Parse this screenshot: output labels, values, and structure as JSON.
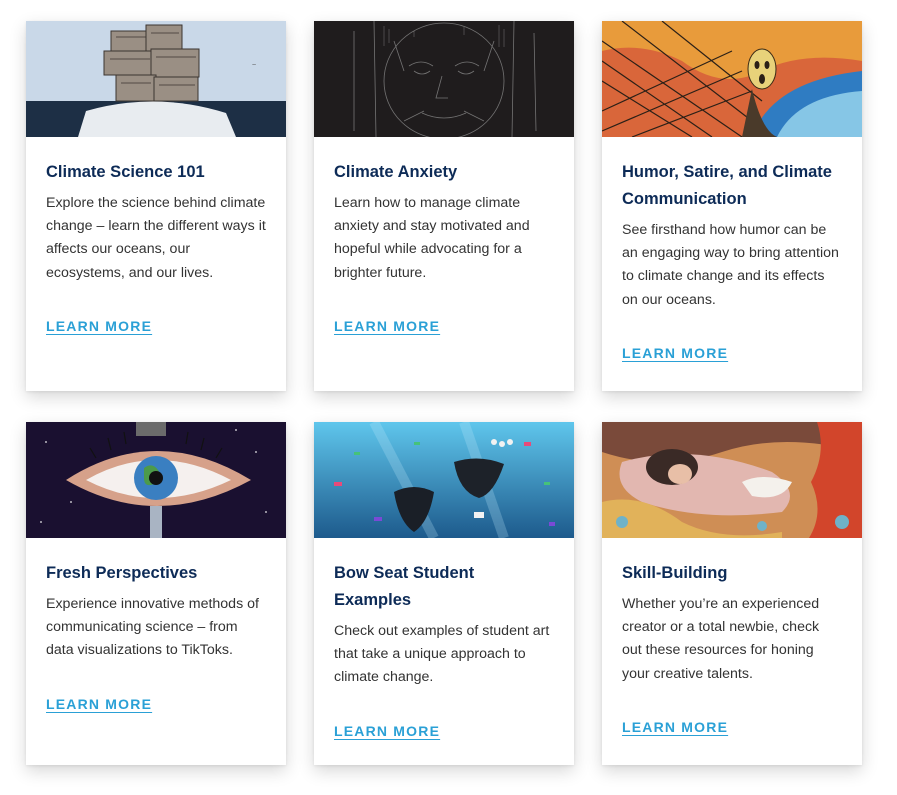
{
  "cards": [
    {
      "title": "Climate Science 101",
      "description": "Explore the science behind climate change – learn the different ways it affects our oceans, our ecosystems, and our lives.",
      "link": "LEARN MORE",
      "image": "stacked-houses-artwork"
    },
    {
      "title": "Climate Anxiety",
      "description": "Learn how to manage climate anxiety and stay motivated and hopeful while advocating for a brighter future.",
      "link": "LEARN MORE",
      "image": "dark-face-artwork"
    },
    {
      "title": "Humor, Satire, and Climate Communication",
      "description": "See firsthand how humor can be an engaging way to bring attention to climate change and its effects on our oceans.",
      "link": "LEARN MORE",
      "image": "scream-parody-artwork"
    },
    {
      "title": "Fresh Perspectives",
      "description": "Experience innovative methods of communicating science – from data visualizations to TikToks.",
      "link": "LEARN MORE",
      "image": "earth-eye-artwork"
    },
    {
      "title": "Bow Seat Student Examples",
      "description": "Check out examples of student art that take a unique approach to climate change.",
      "link": "LEARN MORE",
      "image": "ocean-plastic-artwork"
    },
    {
      "title": "Skill-Building",
      "description": "Whether you’re an experienced creator or a total newbie, check out these resources for honing your creative talents.",
      "link": "LEARN MORE",
      "image": "coral-reef-figure-artwork"
    }
  ]
}
